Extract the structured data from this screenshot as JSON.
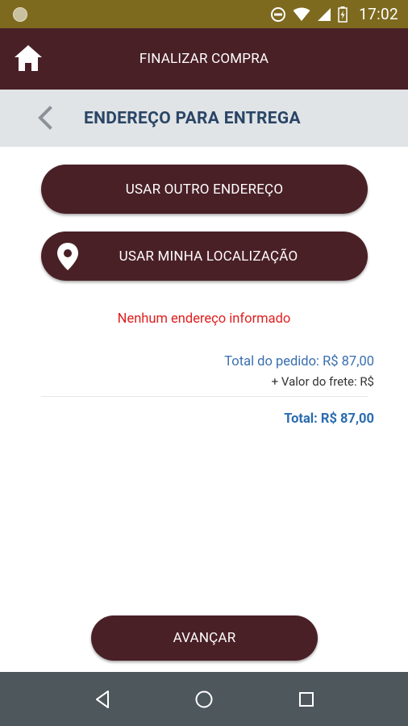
{
  "status_bar": {
    "time": "17:02",
    "icons": [
      "notification-dot-icon",
      "do-not-disturb-icon",
      "wifi-icon",
      "signal-icon",
      "battery-icon"
    ]
  },
  "app_bar": {
    "title": "FINALIZAR COMPRA",
    "home_icon": "home-icon"
  },
  "sub_header": {
    "title": "ENDEREÇO PARA ENTREGA",
    "back_icon": "chevron-left-icon"
  },
  "actions": {
    "other_address_label": "USAR OUTRO ENDEREÇO",
    "my_location_label": "USAR MINHA LOCALIZAÇÃO",
    "my_location_icon": "location-pin-icon"
  },
  "message": {
    "empty_address": "Nenhum endereço informado"
  },
  "totals": {
    "order_total": "Total do pedido: R$ 87,00",
    "shipping": "+ Valor do frete: R$",
    "grand_total": "Total: R$ 87,00"
  },
  "footer": {
    "advance_label": "AVANÇAR"
  },
  "colors": {
    "status_bar": "#7e6a1f",
    "primary": "#4a2027",
    "sub_header_bg": "#e1e4e6",
    "sub_header_text": "#2a4566",
    "error_text": "#e02020",
    "total_text": "#3a6fb0",
    "nav_bar": "#4e575c"
  },
  "nav_bar": {
    "icons": [
      "nav-back-icon",
      "nav-home-icon",
      "nav-recent-apps-icon"
    ]
  }
}
